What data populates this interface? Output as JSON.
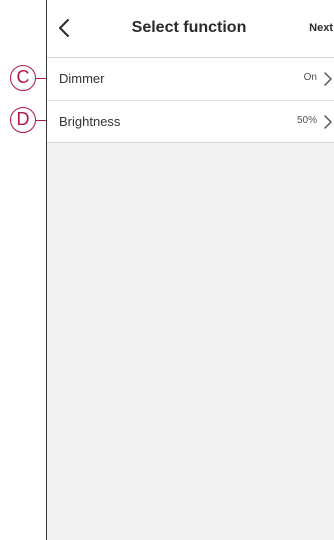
{
  "header": {
    "title": "Select function",
    "next_label": "Next"
  },
  "functions": [
    {
      "label": "Dimmer",
      "value": "On"
    },
    {
      "label": "Brightness",
      "value": "50%"
    }
  ],
  "callouts": [
    "C",
    "D"
  ],
  "colors": {
    "callout": "#b0174a",
    "background": "#f2f2f2",
    "text": "#2b2b2b"
  }
}
